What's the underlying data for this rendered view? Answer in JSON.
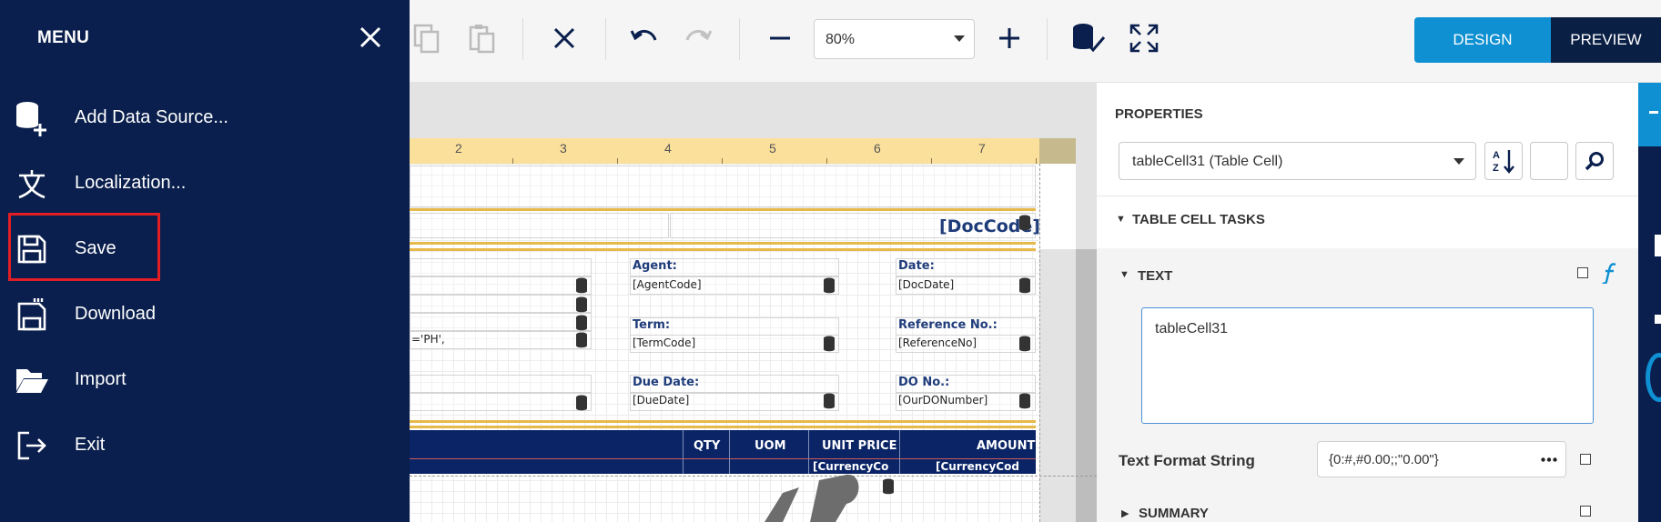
{
  "toolbar": {
    "zoom_value": "80%",
    "design_label": "DESIGN",
    "preview_label": "PREVIEW"
  },
  "menu": {
    "title": "MENU",
    "items": [
      {
        "label": "Add Data Source...",
        "icon": "add-database-icon"
      },
      {
        "label": "Localization...",
        "icon": "localization-icon"
      },
      {
        "label": "Save",
        "icon": "save-icon"
      },
      {
        "label": "Download",
        "icon": "download-icon"
      },
      {
        "label": "Import",
        "icon": "folder-open-icon"
      },
      {
        "label": "Exit",
        "icon": "exit-icon"
      }
    ],
    "highlight_color": "#e21d24"
  },
  "ruler": {
    "numbers": [
      "2",
      "3",
      "4",
      "5",
      "6",
      "7"
    ]
  },
  "report": {
    "doc_code": "[DocCode]",
    "labels": {
      "agent": "Agent:",
      "date": "Date:",
      "term": "Term:",
      "reference_no": "Reference No.:",
      "due_date": "Due Date:",
      "do_no": "DO No.:"
    },
    "fields": {
      "agent_code": "[AgentCode]",
      "doc_date": "[DocDate]",
      "term_code": "[TermCode]",
      "reference_no": "[ReferenceNo]",
      "due_date": "[DueDate]",
      "do_number": "[OurDONumber]",
      "expression_fragment": "='PH',"
    },
    "table_headers": [
      "QTY",
      "UOM",
      "UNIT PRICE",
      "AMOUNT"
    ],
    "currency_cells": [
      "[CurrencyCo",
      "[CurrencyCod"
    ]
  },
  "properties": {
    "title": "PROPERTIES",
    "selected_component": "tableCell31 (Table Cell)",
    "tasks_section": "TABLE CELL TASKS",
    "text_section": "TEXT",
    "text_value": "tableCell31",
    "text_format_label": "Text Format String",
    "text_format_value": "{0:#,#0.00;;\"0.00\"}",
    "summary_section": "SUMMARY"
  },
  "colors": {
    "menu_bg": "#0a1f4d",
    "accent": "#0e90d2",
    "table_header": "#0a2466",
    "ruler": "#fbe09b"
  }
}
